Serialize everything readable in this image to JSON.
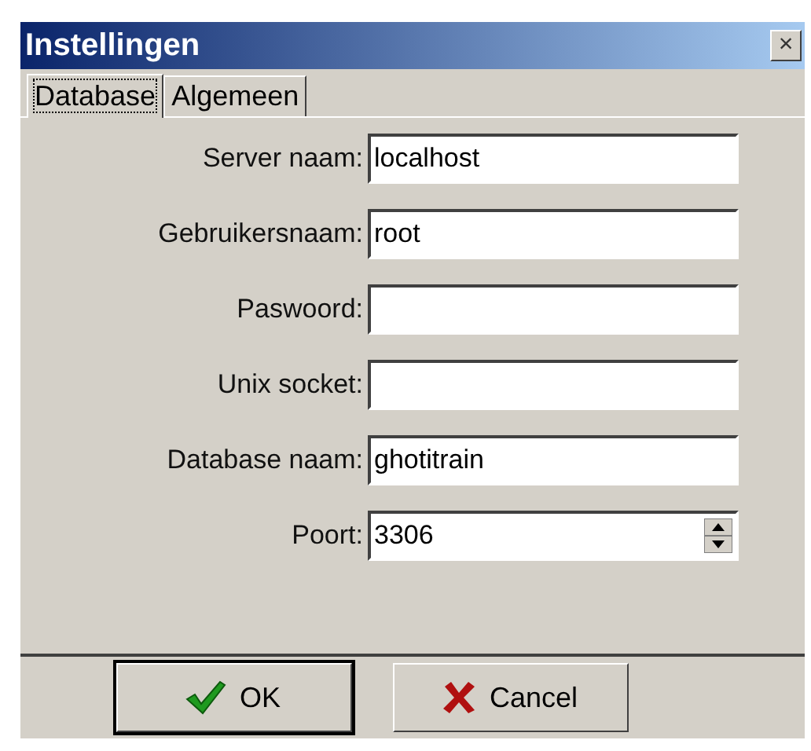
{
  "window": {
    "title": "Instellingen",
    "close": "×"
  },
  "tabs": [
    {
      "label": "Database",
      "selected": true
    },
    {
      "label": "Algemeen",
      "selected": false
    }
  ],
  "fields": [
    {
      "label": "Server naam:",
      "value": "localhost",
      "kind": "text"
    },
    {
      "label": "Gebruikersnaam:",
      "value": "root",
      "kind": "text"
    },
    {
      "label": "Paswoord:",
      "kind": "password"
    },
    {
      "label": "Unix socket:",
      "kind": "text"
    },
    {
      "label": "Database naam:",
      "value": "ghotitrain",
      "kind": "text"
    },
    {
      "label": "Poort:",
      "value": "3306",
      "kind": "spin"
    }
  ],
  "buttons": [
    {
      "label": "OK",
      "kind": "ok"
    },
    {
      "label": "Cancel",
      "kind": "cancel"
    }
  ]
}
